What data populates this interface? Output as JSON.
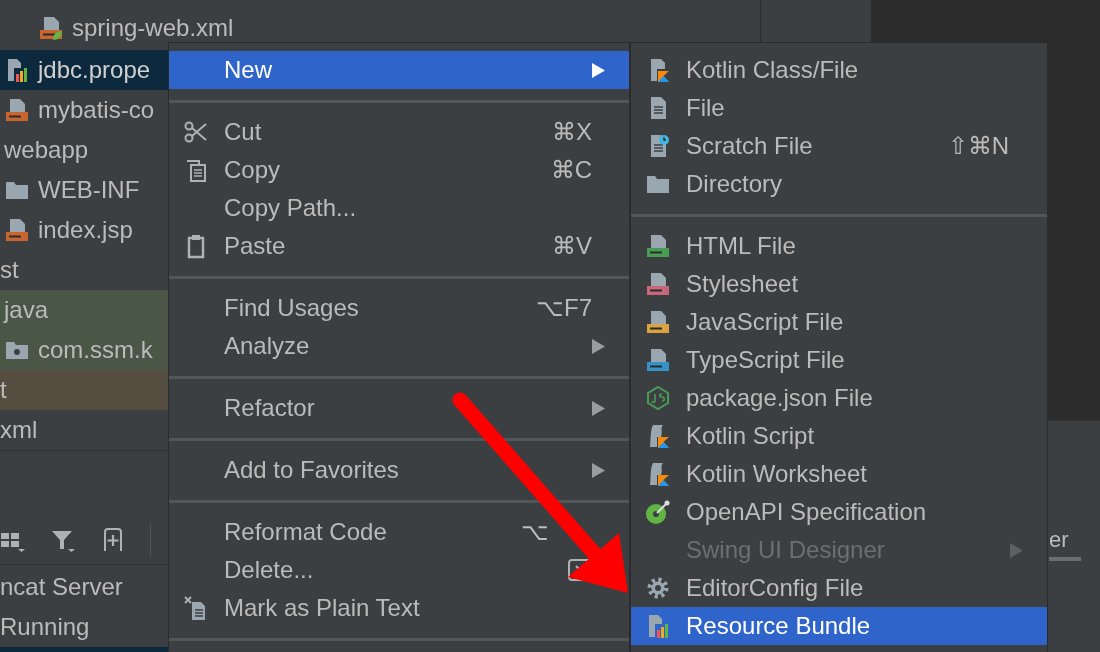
{
  "project_tree": {
    "items": [
      {
        "label": "spring-web.xml",
        "selected": false
      },
      {
        "label": "jdbc.prope",
        "selected": true
      },
      {
        "label": "mybatis-co",
        "selected": false
      },
      {
        "label": "webapp",
        "selected": false,
        "children": [
          {
            "label": "WEB-INF",
            "selected": false
          },
          {
            "label": "index.jsp",
            "selected": false
          }
        ]
      },
      {
        "label": "st",
        "selected": false
      },
      {
        "label": "java",
        "selected": false,
        "color": "#4a5646",
        "children": [
          {
            "label": "com.ssm.k",
            "selected": false,
            "color": "#4a5646"
          }
        ]
      },
      {
        "label": "t",
        "selected": false,
        "color": "#554d3f"
      },
      {
        "label": "xml",
        "selected": false
      }
    ]
  },
  "run_list": {
    "items": [
      {
        "label": "ncat Server"
      },
      {
        "label": "Running"
      }
    ]
  },
  "side_tab": {
    "label": "er"
  },
  "context_menu": {
    "items": [
      {
        "kind": "item",
        "label": "New",
        "selected": true,
        "submenu": true
      },
      {
        "kind": "separator"
      },
      {
        "kind": "item",
        "label": "Cut",
        "shortcut": "⌘X",
        "selected": false
      },
      {
        "kind": "item",
        "label": "Copy",
        "shortcut": "⌘C",
        "selected": false
      },
      {
        "kind": "item",
        "label": "Copy Path...",
        "selected": false
      },
      {
        "kind": "item",
        "label": "Paste",
        "shortcut": "⌘V",
        "selected": false
      },
      {
        "kind": "separator"
      },
      {
        "kind": "item",
        "label": "Find Usages",
        "shortcut": "⌥F7",
        "selected": false
      },
      {
        "kind": "item",
        "label": "Analyze",
        "selected": false,
        "submenu": true
      },
      {
        "kind": "separator"
      },
      {
        "kind": "item",
        "label": "Refactor",
        "selected": false,
        "submenu": true
      },
      {
        "kind": "separator"
      },
      {
        "kind": "item",
        "label": "Add to Favorites",
        "selected": false,
        "submenu": true
      },
      {
        "kind": "separator"
      },
      {
        "kind": "item",
        "label": "Reformat Code",
        "shortcut": "⌥",
        "selected": false
      },
      {
        "kind": "item",
        "label": "Delete...",
        "selected": false
      },
      {
        "kind": "item",
        "label": "Mark as Plain Text",
        "selected": false
      },
      {
        "kind": "separator"
      }
    ]
  },
  "new_submenu": {
    "items": [
      {
        "kind": "item",
        "label": "Kotlin Class/File",
        "selected": false
      },
      {
        "kind": "item",
        "label": "File",
        "selected": false
      },
      {
        "kind": "item",
        "label": "Scratch File",
        "shortcut": "⇧⌘N",
        "selected": false
      },
      {
        "kind": "item",
        "label": "Directory",
        "selected": false
      },
      {
        "kind": "separator"
      },
      {
        "kind": "item",
        "label": "HTML File",
        "selected": false
      },
      {
        "kind": "item",
        "label": "Stylesheet",
        "selected": false
      },
      {
        "kind": "item",
        "label": "JavaScript File",
        "selected": false
      },
      {
        "kind": "item",
        "label": "TypeScript File",
        "selected": false
      },
      {
        "kind": "item",
        "label": "package.json File",
        "selected": false
      },
      {
        "kind": "item",
        "label": "Kotlin Script",
        "selected": false
      },
      {
        "kind": "item",
        "label": "Kotlin Worksheet",
        "selected": false
      },
      {
        "kind": "item",
        "label": "OpenAPI Specification",
        "selected": false
      },
      {
        "kind": "item",
        "label": "Swing UI Designer",
        "selected": false,
        "disabled": true,
        "submenu": true
      },
      {
        "kind": "item",
        "label": "EditorConfig File",
        "selected": false
      },
      {
        "kind": "item",
        "label": "Resource Bundle",
        "selected": true
      }
    ]
  }
}
